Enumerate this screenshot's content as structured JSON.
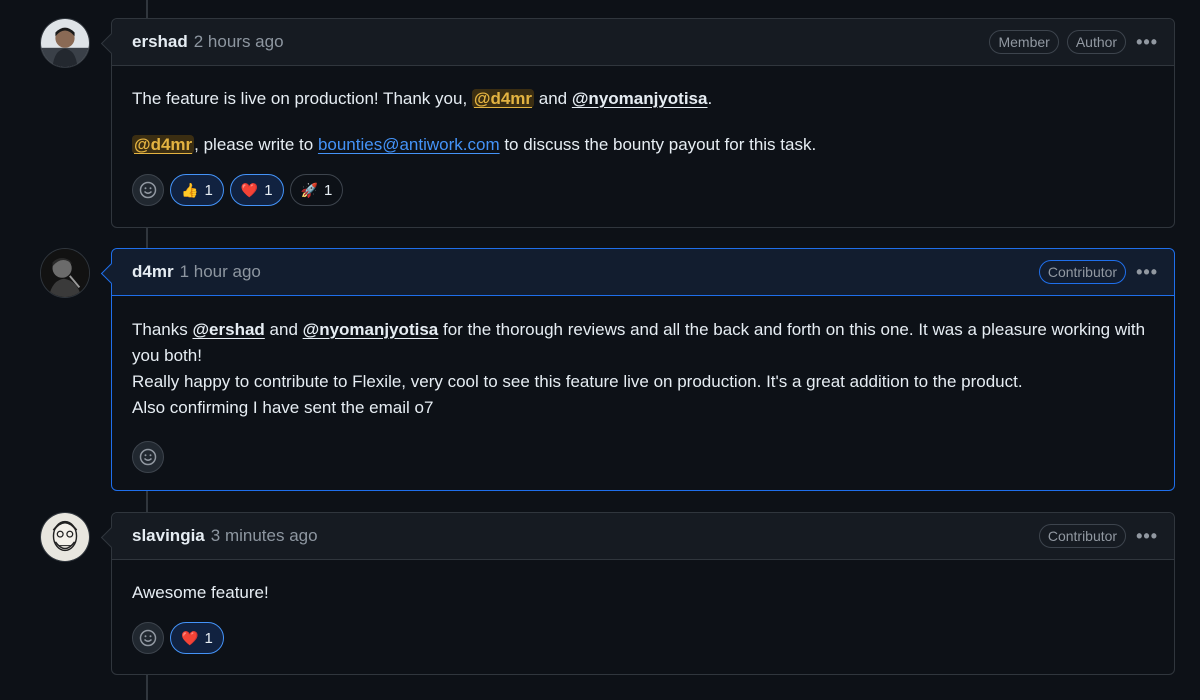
{
  "comments": [
    {
      "author": "ershad",
      "time": "2 hours ago",
      "badges": [
        "Member",
        "Author"
      ],
      "body": {
        "p1": {
          "prefix": "The feature is live on production! Thank you, ",
          "mention1": "@d4mr",
          "mid": " and ",
          "mention2": "@nyomanjyotisa",
          "suffix": "."
        },
        "p2": {
          "mention": "@d4mr",
          "mid": ", please write to ",
          "link": "bounties@antiwork.com",
          "suffix": " to discuss the bounty payout for this task."
        }
      },
      "reactions": [
        {
          "icon": "thumbs-up-icon",
          "glyph": "👍",
          "count": "1"
        },
        {
          "icon": "heart-icon",
          "glyph": "❤️",
          "count": "1"
        },
        {
          "icon": "rocket-icon",
          "glyph": "🚀",
          "count": "1"
        }
      ]
    },
    {
      "author": "d4mr",
      "time": "1 hour ago",
      "badges": [
        "Contributor"
      ],
      "body": {
        "prefix": "Thanks ",
        "mention1": "@ershad",
        "mid": " and ",
        "mention2": "@nyomanjyotisa",
        "suffix": " for the thorough reviews and all the back and forth on this one. It was a pleasure working with you both!",
        "line2": "Really happy to contribute to Flexile, very cool to see this feature live on production. It's a great addition to the product.",
        "line3": "Also confirming I have sent the email o7"
      }
    },
    {
      "author": "slavingia",
      "time": "3 minutes ago",
      "badges": [
        "Contributor"
      ],
      "body": {
        "text": "Awesome feature!"
      },
      "reactions": [
        {
          "icon": "heart-icon",
          "glyph": "❤️",
          "count": "1"
        }
      ]
    }
  ],
  "more_label": "•••",
  "colors": {
    "background": "#0d1117",
    "header": "#161b22",
    "border": "#30363d",
    "highlight_border": "#1f6feb",
    "link": "#4493f8",
    "self_mention": "#e3b341"
  }
}
